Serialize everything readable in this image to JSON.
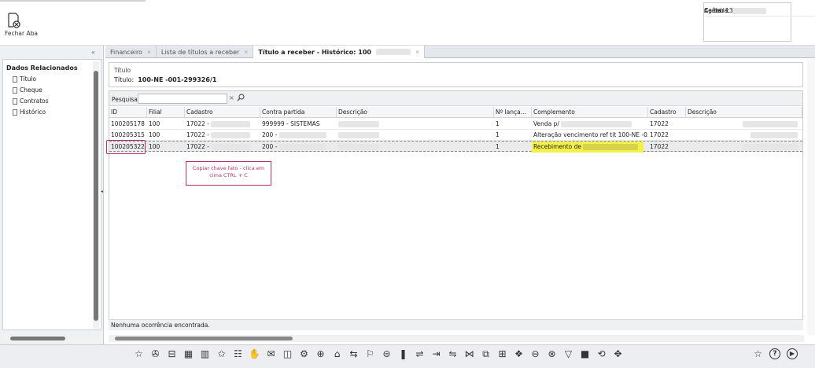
{
  "topbar": {
    "close_label": "Fechar Aba"
  },
  "info": {
    "carteira_label": "Carteira:",
    "conta_label": "Conta:",
    "conta_value": "13",
    "agencia_label": "Agência:"
  },
  "left": {
    "collapse": "«",
    "title": "Dados Relacionados",
    "items": [
      "Título",
      "Cheque",
      "Contratos",
      "Histórico"
    ]
  },
  "tabs": [
    {
      "label": "Financeiro",
      "close": "×"
    },
    {
      "label": "Lista de títulos a receber",
      "close": "×"
    },
    {
      "label": "Título a receber - Histórico: 100",
      "close": "×"
    }
  ],
  "titulo": {
    "label": "Título",
    "prefix": "Título:",
    "value": "100-NE -001-299326/1"
  },
  "search": {
    "label": "Pesquisar",
    "clear": "×",
    "value": ""
  },
  "columns": [
    "ID",
    "Filial",
    "Cadastro",
    "Contra partida",
    "Descrição",
    "Nº lança...",
    "Complemento",
    "Cadastro",
    "Descrição"
  ],
  "rows": [
    {
      "id": "100205178",
      "filial": "100",
      "cadastro": "17022 -",
      "contra": "999999 - SISTEMAS",
      "lanc": "1",
      "complemento": "Venda p/",
      "cadastro2": "17022"
    },
    {
      "id": "100205315",
      "filial": "100",
      "cadastro": "17022 -",
      "contra": "200 -",
      "lanc": "1",
      "complemento": "Alteração vencimento ref tit 100-NE -0...",
      "cadastro2": "17022"
    },
    {
      "id": "100205322",
      "filial": "100",
      "cadastro": "17022 -",
      "contra": "200 -",
      "lanc": "1",
      "complemento": "Recebimento de",
      "cadastro2": "17022"
    }
  ],
  "status": "Nenhuma ocorrência encontrada.",
  "note": "Copiar chave fato - clica em cima CTRL + C",
  "toolbar": [
    "☆",
    "✇",
    "⊟",
    "▦",
    "▥",
    "✩",
    "☷",
    "✋",
    "✉",
    "◫",
    "⚙",
    "⊕",
    "⌂",
    "⇆",
    "⚐",
    "⊜",
    "❚",
    "⇌",
    "⇥",
    "⇋",
    "⋈",
    "⧉",
    "⊞",
    "❖",
    "⊖",
    "⊗",
    "▽",
    "■",
    "⟲",
    "✥"
  ],
  "toolbar_right": [
    "☆",
    "?",
    "▶"
  ]
}
